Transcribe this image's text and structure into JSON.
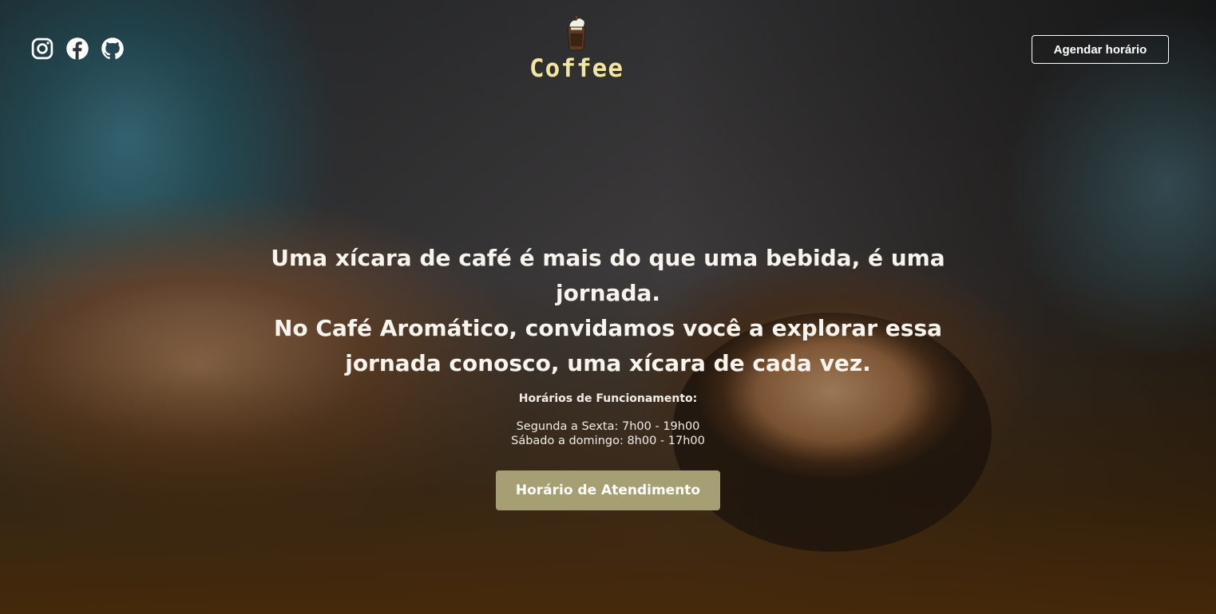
{
  "header": {
    "socials": [
      {
        "icon": "instagram-icon"
      },
      {
        "icon": "facebook-icon"
      },
      {
        "icon": "github-icon"
      }
    ],
    "logo_text": "Coffee",
    "cta_label": "Agendar horário"
  },
  "hero": {
    "headline_lines": [
      "Uma xícara de café é mais do que uma bebida, é uma jornada.",
      "No Café Aromático, convidamos você a explorar essa",
      "jornada conosco, uma xícara de cada vez."
    ],
    "hours_title": "Horários de Funcionamento:",
    "hours": [
      "Segunda a Sexta: 7h00 - 19h00",
      "Sábado a domingo: 8h00 - 17h00"
    ],
    "cta_label": "Horário de Atendimento"
  },
  "colors": {
    "logo_text": "#efe6a4",
    "cta_main_bg": "#a59f73",
    "text": "#ffffff"
  }
}
